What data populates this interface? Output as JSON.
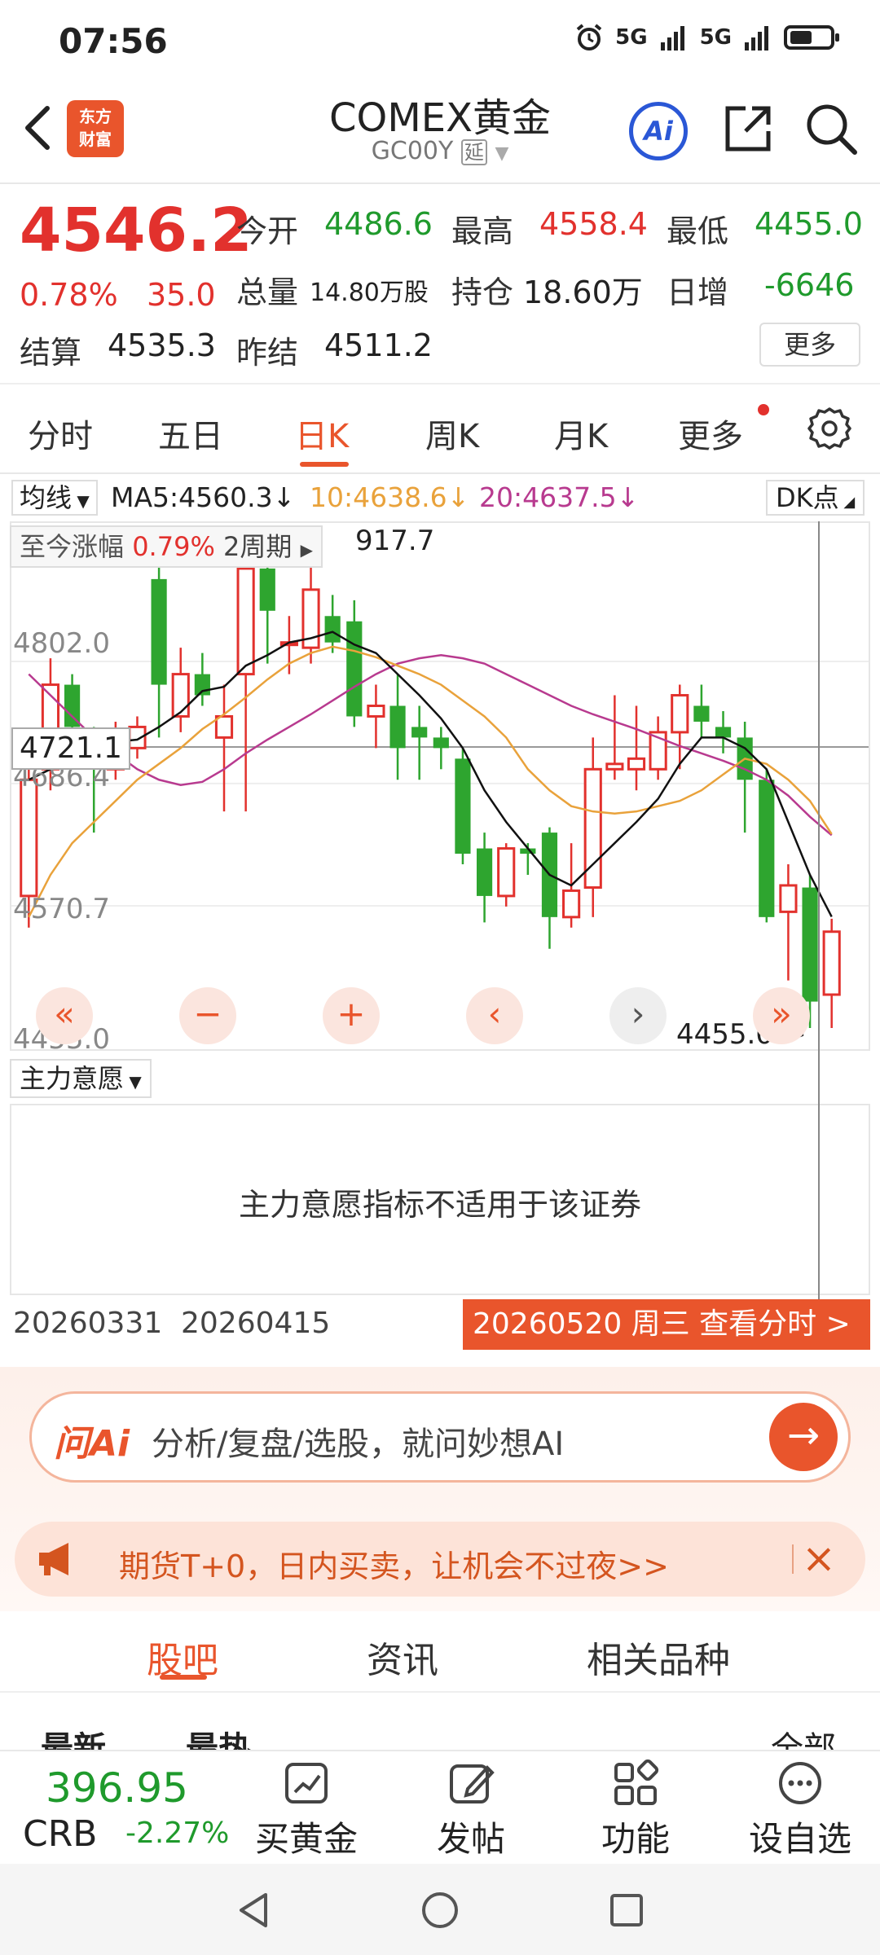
{
  "status_bar": {
    "time": "07:56",
    "network": "5G",
    "network2": "5G"
  },
  "header": {
    "logo_line1": "东方",
    "logo_line2": "财富",
    "title": "COMEX黄金",
    "subtitle": "GC00Y",
    "delay_tag": "延",
    "ai_label": "Ai"
  },
  "quote": {
    "price": "4546.2",
    "change_pct": "0.78%",
    "change_amt": "35.0",
    "open_label": "今开",
    "open": "4486.6",
    "high_label": "最高",
    "high": "4558.4",
    "low_label": "最低",
    "low": "4455.0",
    "volume_label": "总量",
    "volume": "14.80万股",
    "oi_label": "持仓",
    "oi": "18.60万",
    "daily_inc_label": "日增",
    "daily_inc": "-6646",
    "settle_label": "结算",
    "settle": "4535.3",
    "prev_settle_label": "昨结",
    "prev_settle": "4511.2",
    "more": "更多"
  },
  "period_tabs": [
    "分时",
    "五日",
    "日K",
    "周K",
    "月K",
    "更多"
  ],
  "active_period": "日K",
  "ma_row": {
    "select": "均线",
    "ma5": "MA5:4560.3",
    "ma10": "10:4638.6",
    "ma20": "20:4637.5",
    "dk": "DK点"
  },
  "chart": {
    "range_label": "至今涨幅",
    "range_value": "0.79%",
    "range_period": "2周期",
    "high_value": "917.7",
    "y_labels": [
      "4802.0",
      "4686.4",
      "4570.7",
      "4455.0"
    ],
    "crosshair_value": "4721.1",
    "low_marker": "4455.0->",
    "colors": {
      "up": "#e2312d",
      "down": "#2ea52f",
      "ma5": "#111111",
      "ma10": "#e9a23b",
      "ma20": "#b83a8f"
    }
  },
  "chart_data": {
    "type": "candlestick",
    "ylim": [
      4455.0,
      4917.7
    ],
    "candles": [
      {
        "o": 4580,
        "c": 4690,
        "h": 4720,
        "l": 4550
      },
      {
        "o": 4700,
        "c": 4780,
        "h": 4805,
        "l": 4680
      },
      {
        "o": 4780,
        "c": 4740,
        "h": 4790,
        "l": 4710
      },
      {
        "o": 4720,
        "c": 4700,
        "h": 4740,
        "l": 4640
      },
      {
        "o": 4700,
        "c": 4720,
        "h": 4745,
        "l": 4690
      },
      {
        "o": 4720,
        "c": 4740,
        "h": 4750,
        "l": 4710
      },
      {
        "o": 4880,
        "c": 4780,
        "h": 4925,
        "l": 4730
      },
      {
        "o": 4750,
        "c": 4790,
        "h": 4815,
        "l": 4735
      },
      {
        "o": 4790,
        "c": 4770,
        "h": 4810,
        "l": 4760
      },
      {
        "o": 4730,
        "c": 4750,
        "h": 4780,
        "l": 4660
      },
      {
        "o": 4790,
        "c": 4890,
        "h": 4900,
        "l": 4660
      },
      {
        "o": 4890,
        "c": 4850,
        "h": 4905,
        "l": 4800
      },
      {
        "o": 4820,
        "c": 4820,
        "h": 4845,
        "l": 4790
      },
      {
        "o": 4815,
        "c": 4870,
        "h": 4900,
        "l": 4800
      },
      {
        "o": 4845,
        "c": 4820,
        "h": 4865,
        "l": 4810
      },
      {
        "o": 4840,
        "c": 4750,
        "h": 4860,
        "l": 4740
      },
      {
        "o": 4750,
        "c": 4760,
        "h": 4780,
        "l": 4720
      },
      {
        "o": 4760,
        "c": 4720,
        "h": 4790,
        "l": 4690
      },
      {
        "o": 4740,
        "c": 4730,
        "h": 4760,
        "l": 4690
      },
      {
        "o": 4730,
        "c": 4720,
        "h": 4740,
        "l": 4700
      },
      {
        "o": 4710,
        "c": 4620,
        "h": 4720,
        "l": 4610
      },
      {
        "o": 4625,
        "c": 4580,
        "h": 4640,
        "l": 4555
      },
      {
        "o": 4580,
        "c": 4625,
        "h": 4630,
        "l": 4570
      },
      {
        "o": 4625,
        "c": 4620,
        "h": 4630,
        "l": 4600
      },
      {
        "o": 4640,
        "c": 4560,
        "h": 4645,
        "l": 4530
      },
      {
        "o": 4560,
        "c": 4585,
        "h": 4630,
        "l": 4550
      },
      {
        "o": 4588,
        "c": 4700,
        "h": 4730,
        "l": 4560
      },
      {
        "o": 4700,
        "c": 4705,
        "h": 4770,
        "l": 4690
      },
      {
        "o": 4700,
        "c": 4710,
        "h": 4760,
        "l": 4680
      },
      {
        "o": 4700,
        "c": 4735,
        "h": 4750,
        "l": 4690
      },
      {
        "o": 4735,
        "c": 4770,
        "h": 4780,
        "l": 4700
      },
      {
        "o": 4760,
        "c": 4745,
        "h": 4780,
        "l": 4730
      },
      {
        "o": 4740,
        "c": 4730,
        "h": 4755,
        "l": 4715
      },
      {
        "o": 4730,
        "c": 4690,
        "h": 4745,
        "l": 4640
      },
      {
        "o": 4690,
        "c": 4560,
        "h": 4700,
        "l": 4555
      },
      {
        "o": 4565,
        "c": 4590,
        "h": 4610,
        "l": 4500
      },
      {
        "o": 4588,
        "c": 4480,
        "h": 4600,
        "l": 4455
      },
      {
        "o": 4486.6,
        "c": 4546.2,
        "h": 4558.4,
        "l": 4455.0
      }
    ],
    "ma5": [
      4690,
      4700,
      4716,
      4726,
      4726,
      4728,
      4740,
      4754,
      4774,
      4778,
      4798,
      4808,
      4820,
      4824,
      4830,
      4818,
      4810,
      4790,
      4770,
      4748,
      4720,
      4680,
      4650,
      4625,
      4600,
      4590,
      4610,
      4630,
      4650,
      4672,
      4705,
      4730,
      4730,
      4720,
      4700,
      4650,
      4600,
      4560.3
    ],
    "ma10": [
      4560,
      4600,
      4630,
      4650,
      4670,
      4690,
      4705,
      4720,
      4738,
      4752,
      4768,
      4785,
      4800,
      4810,
      4816,
      4812,
      4806,
      4798,
      4790,
      4780,
      4765,
      4750,
      4730,
      4700,
      4680,
      4665,
      4660,
      4658,
      4660,
      4665,
      4670,
      4680,
      4695,
      4710,
      4705,
      4690,
      4670,
      4638.6
    ],
    "ma20": [
      4790,
      4770,
      4750,
      4730,
      4715,
      4700,
      4690,
      4685,
      4688,
      4700,
      4715,
      4728,
      4740,
      4752,
      4765,
      4778,
      4790,
      4800,
      4805,
      4808,
      4805,
      4800,
      4790,
      4780,
      4770,
      4760,
      4752,
      4745,
      4738,
      4730,
      4722,
      4715,
      4708,
      4700,
      4690,
      4675,
      4655,
      4637.5
    ],
    "x_labels": [
      "20260331",
      "20260415"
    ]
  },
  "indicator": {
    "select": "主力意愿",
    "message": "主力意愿指标不适用于该证券"
  },
  "cursor_date": "20260520 周三 查看分时 >",
  "ask_ai": {
    "logo": "问Ai",
    "text": "分析/复盘/选股，就问妙想AI"
  },
  "promo": {
    "text": "期货T+0，日内买卖，让机会不过夜>>"
  },
  "community_tabs": [
    "股吧",
    "资讯",
    "相关品种"
  ],
  "sort_row": {
    "left1": "最新",
    "left2": "最热",
    "right": "全部"
  },
  "bottom_bar": {
    "crb_price": "396.95",
    "crb_name": "CRB",
    "crb_change": "-2.27%",
    "items": [
      "买黄金",
      "发帖",
      "功能",
      "设自选"
    ]
  }
}
